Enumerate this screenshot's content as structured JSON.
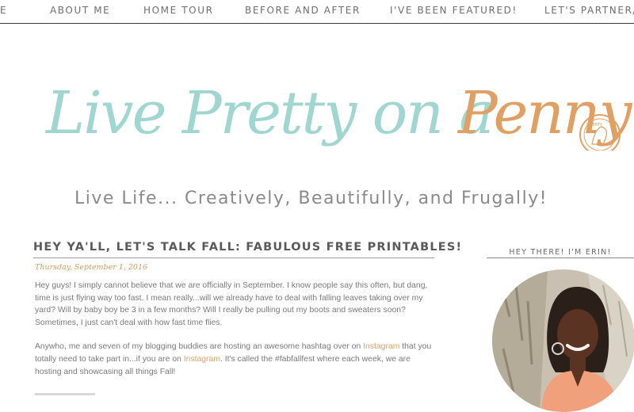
{
  "nav": {
    "items": [
      {
        "label": "ME"
      },
      {
        "label": "ABOUT ME"
      },
      {
        "label": "HOME TOUR"
      },
      {
        "label": "BEFORE AND AFTER"
      },
      {
        "label": "I'VE BEEN FEATURED!"
      },
      {
        "label": "LET'S PARTNER/"
      }
    ]
  },
  "header": {
    "logo_text_1": "Live Pretty on a",
    "logo_text_2": "Penny",
    "tagline": "Live Life... Creatively, Beautifully, and Frugally!",
    "colors": {
      "mint": "#9fd6cf",
      "orange": "#e0a063",
      "gray": "#8a8a8a"
    }
  },
  "post": {
    "title": "HEY YA'LL, LET'S TALK FALL: FABULOUS FREE PRINTABLES!",
    "date": "Thursday, September 1, 2016",
    "p1": "Hey guys! I simply cannot believe that we are officially in September. I know people say this often, but dang, time is just flying way too fast. I mean really...will we already have to deal with falling leaves taking over my yard? Will by baby boy be 3 in a few months? Will I really be pulling out my boots and sweaters soon? Sometimes, I just can't deal with how fast time flies.",
    "p2_a": "Anywho, me and seven of my blogging buddies are hosting an awesome hashtag over on ",
    "p2_link1": "Instagram",
    "p2_b": " that you totally need to take part in...if you are on ",
    "p2_link2": "Instagram",
    "p2_c": ". It's called the #fabfallfest where each week, we are hosting and showcasing all things Fall!"
  },
  "sidebar": {
    "title": "HEY THERE! I'M ERIN!"
  }
}
